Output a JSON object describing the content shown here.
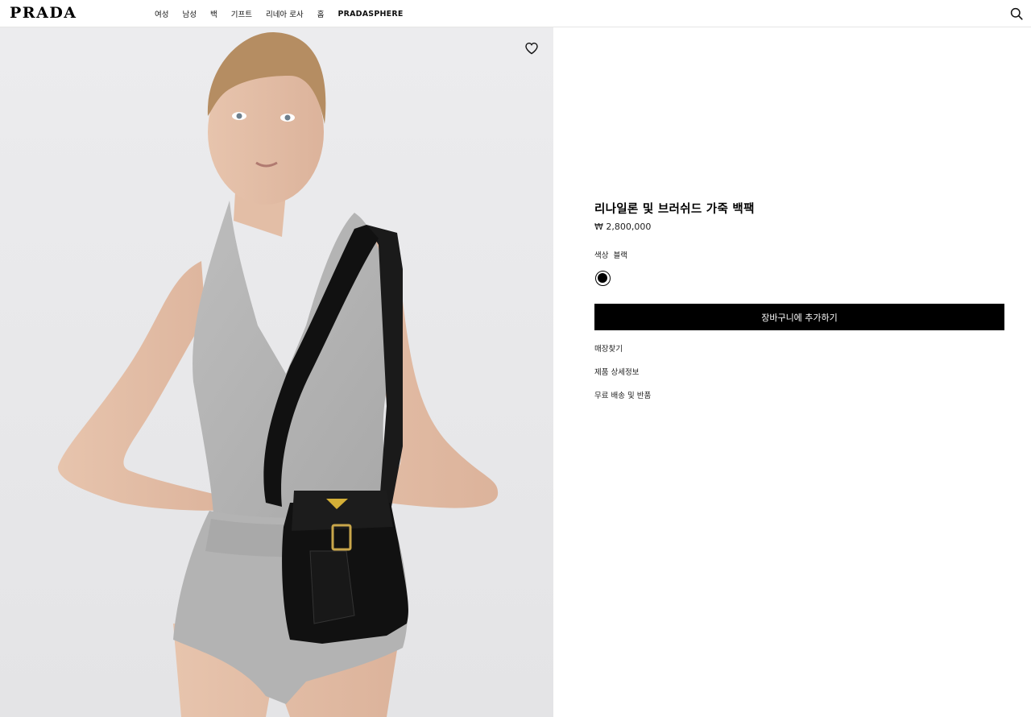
{
  "header": {
    "logo": "PRADA",
    "nav": [
      "여성",
      "남성",
      "백",
      "기프트",
      "리네아 로사",
      "홈"
    ],
    "nav_highlight": "PRADASPHERE",
    "search_icon": "search-icon"
  },
  "product": {
    "title": "리나일론 및 브러쉬드 가죽 백팩",
    "price": "₩ 2,800,000",
    "color_label": "색상",
    "color_value": "블랙",
    "swatch_color": "#000000",
    "add_to_cart": "장바구니에 추가하기",
    "links": {
      "store": "매장찾기",
      "details": "제품 상세정보",
      "shipping": "무료 배송 및 반품"
    },
    "wishlist_icon": "heart-icon"
  },
  "colors": {
    "hero_bg": "#e9e9eb",
    "button_bg": "#000000"
  }
}
